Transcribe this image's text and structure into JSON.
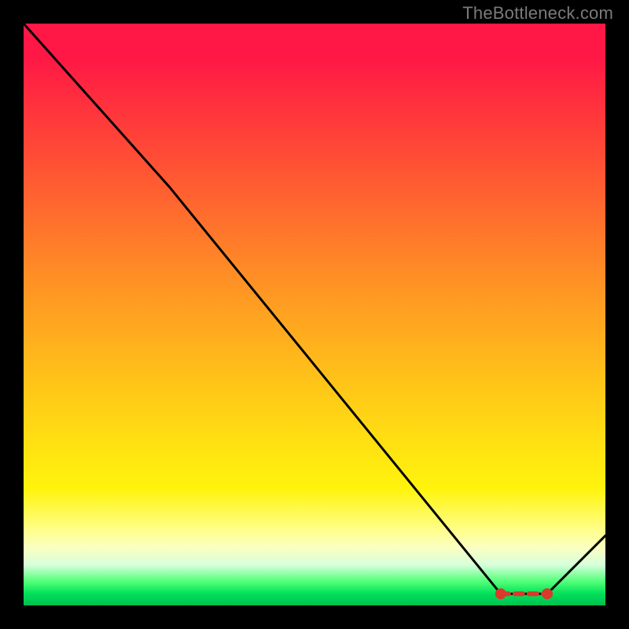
{
  "watermark": {
    "text": "TheBottleneck.com"
  },
  "chart_data": {
    "type": "line",
    "title": "",
    "xlabel": "",
    "ylabel": "",
    "xlim": [
      0,
      100
    ],
    "ylim": [
      0,
      100
    ],
    "x": [
      0,
      25,
      82,
      90,
      100
    ],
    "values": [
      100,
      72,
      2,
      2,
      12
    ],
    "marker_band": {
      "x_start": 82,
      "x_end": 90,
      "y": 2
    },
    "annotations": []
  }
}
